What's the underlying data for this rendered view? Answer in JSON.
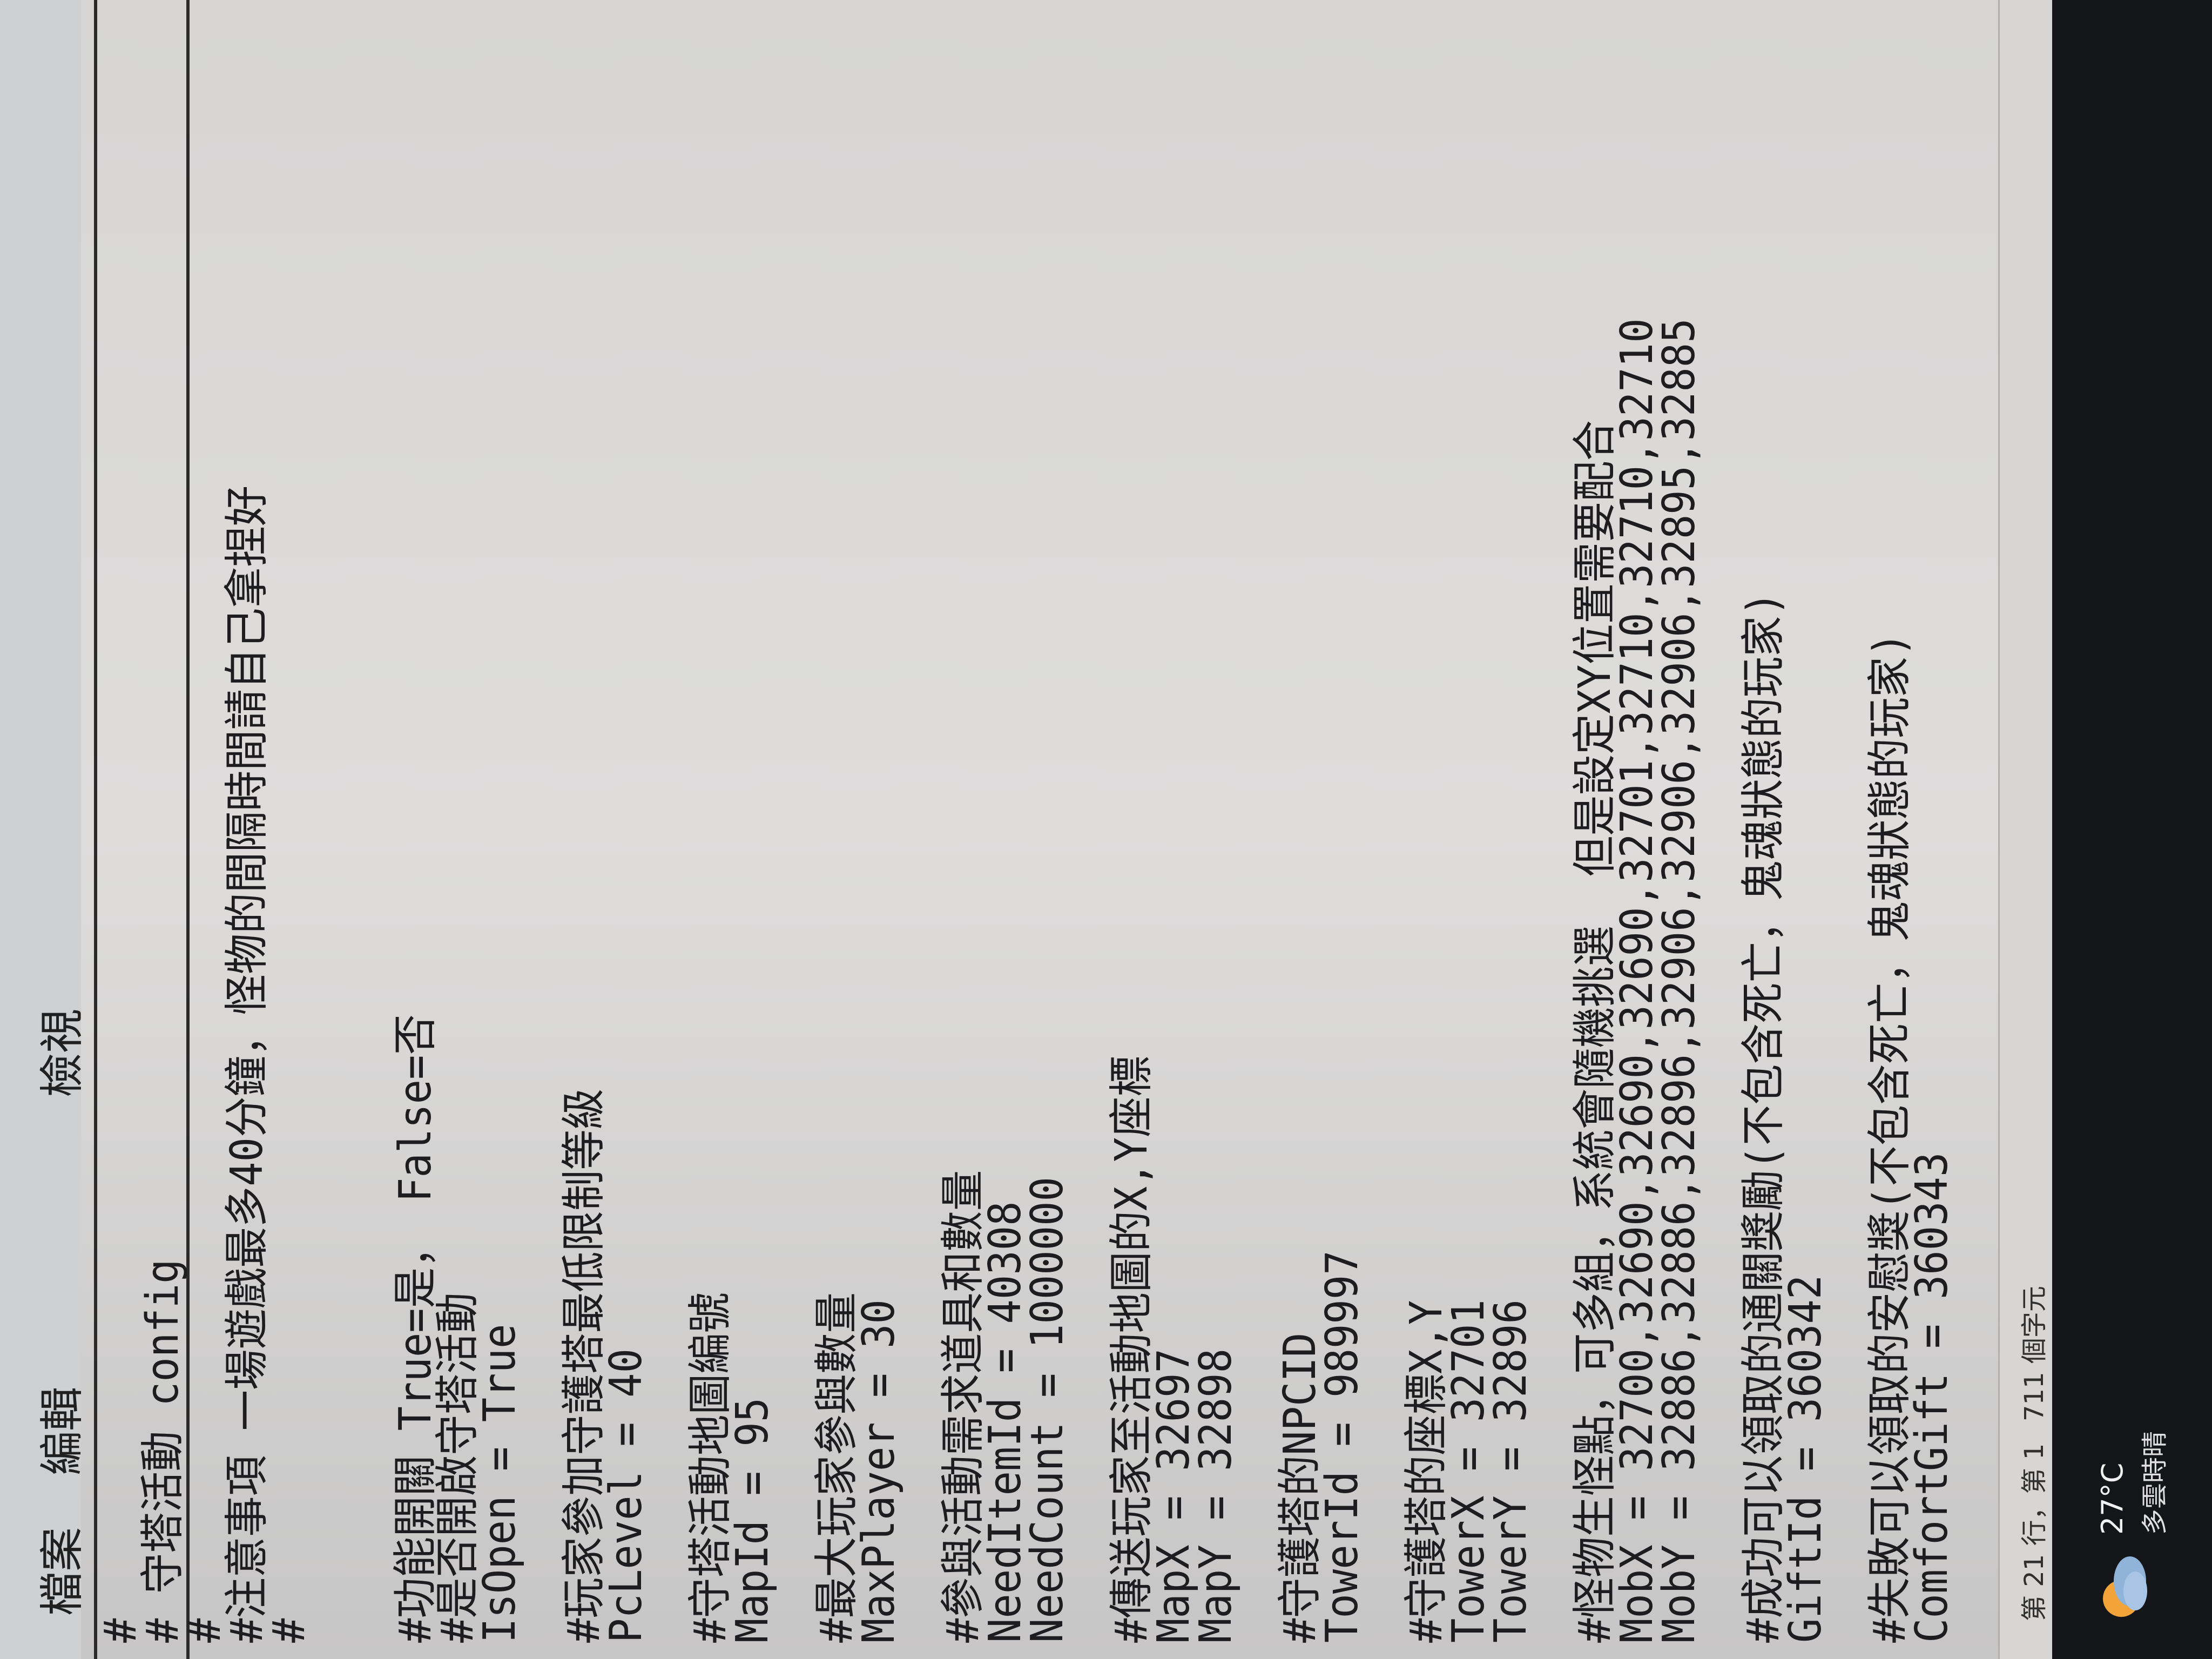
{
  "menu": {
    "file": "檔案",
    "edit": "編輯",
    "view": "檢視"
  },
  "editor": {
    "lines": [
      "#",
      "# 守塔活動 config",
      "#",
      "#注意事項 一場遊戲最多40分鐘，怪物的間隔時間請自己拿捏好",
      "#",
      "",
      "",
      "#功能開關 True=是， False=否",
      "#是否開啟守塔活動",
      "IsOpen = True",
      "",
      "#玩家參加守護塔最低限制等級",
      "PcLevel = 40",
      "",
      "#守塔活動地圖編號",
      "MapId = 95",
      "",
      "#最大玩家參與數量",
      "MaxPlayer = 30",
      "",
      "#參與活動需求道具和數量",
      "NeedItemId = 40308",
      "NeedCount = 1000000",
      "",
      "#傳送玩家至活動地圖的X,Y座標",
      "MapX = 32697",
      "MapY = 32898",
      "",
      "#守護塔的NPCID",
      "TowerId = 989997",
      "",
      "#守護塔的座標X,Y",
      "TowerX = 32701",
      "TowerY = 32896",
      "",
      "#怪物生怪點，可多組，系統會隨機挑選  但是設定XY位置需要配合",
      "MobX = 32700,32690,32690,32690,32701,32710,32710,32710",
      "MobY = 32886,32886,32896,32906,32906,32906,32895,32885",
      "",
      "#成功可以領取的通關獎勵(不包含死亡，鬼魂狀態的玩家)",
      "GiftId = 360342",
      "",
      "#失敗可以領取的安慰獎(不包含死亡，鬼魂狀態的玩家)",
      "ComfortGift = 360343"
    ]
  },
  "status": {
    "position": "第 21 行，第 1",
    "count": "711 個字元"
  },
  "taskbar": {
    "weather_temp": "27°C",
    "weather_desc": "多雲時晴",
    "weather_icon": "partly-sunny-icon"
  }
}
